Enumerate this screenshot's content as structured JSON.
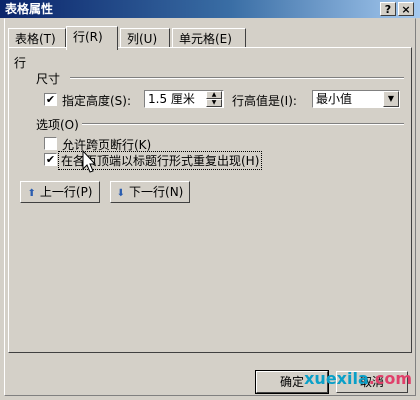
{
  "window": {
    "title": "表格属性",
    "help_glyph": "?",
    "close_glyph": "×"
  },
  "tabs": [
    {
      "label": "表格(T)"
    },
    {
      "label": "行(R)"
    },
    {
      "label": "列(U)"
    },
    {
      "label": "单元格(E)"
    }
  ],
  "row_tab": {
    "section_title": "行",
    "size_group": "尺寸",
    "specify_height": {
      "label": "指定高度(S):",
      "checked": true
    },
    "height_value": "1.5 厘米",
    "row_height_is": {
      "label": "行高值是(I):",
      "value": "最小值"
    },
    "options_group": "选项(O)",
    "allow_break": {
      "label": "允许跨页断行(K)",
      "checked": false
    },
    "repeat_header": {
      "label": "在各页顶端以标题行形式重复出现(H)",
      "checked": true
    },
    "prev_row_button": "上一行(P)",
    "next_row_button": "下一行(N)"
  },
  "footer": {
    "ok_button": "确定",
    "cancel_button": "取消"
  },
  "watermark": {
    "main": "xuexila",
    "dot": ".",
    "tld": "com"
  },
  "icons": {
    "up": "arrow-up-icon",
    "down": "arrow-down-icon",
    "check": "✔"
  },
  "colors": {
    "title_bar_start": "#0a246a",
    "dialog_bg": "#d4d0c8",
    "arrow_blue": "#2a5db0"
  }
}
